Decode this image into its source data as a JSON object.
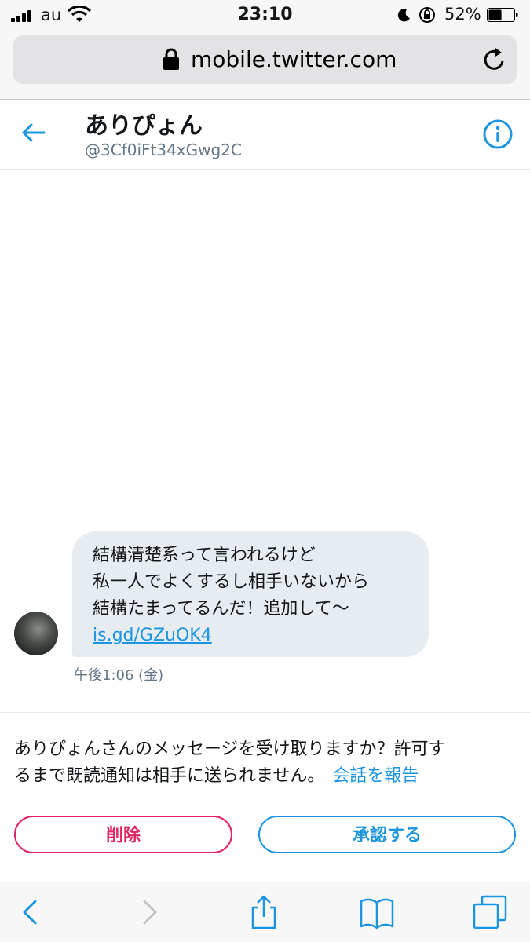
{
  "status_bar": {
    "carrier": "au",
    "time": "23:10",
    "battery_percent": "52%",
    "battery_level": 0.52,
    "icons": [
      "signal-icon",
      "wifi-icon",
      "moon-icon",
      "orientation-lock-icon",
      "battery-icon"
    ]
  },
  "browser": {
    "url": "mobile.twitter.com",
    "icons": [
      "lock-icon",
      "reload-icon"
    ]
  },
  "header": {
    "name": "ありぴょん",
    "handle": "@3Cf0iFt34xGwg2C",
    "icons": [
      "back-arrow-icon",
      "info-icon"
    ]
  },
  "message": {
    "lines": [
      "結構清楚系って言われるけど",
      "私一人でよくするし相手いないから",
      "結構たまってるんだ！追加して〜"
    ],
    "link": "is.gd/GZuOK4",
    "timestamp": "午後1:06 (金)"
  },
  "request": {
    "text_line1": "ありぴょんさんのメッセージを受け取りますか？許可す",
    "text_line2": "るまで既読通知は相手に送られません。",
    "report_label": "会話を報告",
    "delete_label": "削除",
    "accept_label": "承認する"
  },
  "colors": {
    "accent": "#1b95e0",
    "danger": "#e0245e",
    "bubble": "#e6ecf0",
    "muted": "#657786"
  },
  "toolbar": {
    "icons": [
      "back-icon",
      "forward-icon",
      "share-icon",
      "bookmarks-icon",
      "tabs-icon"
    ]
  }
}
